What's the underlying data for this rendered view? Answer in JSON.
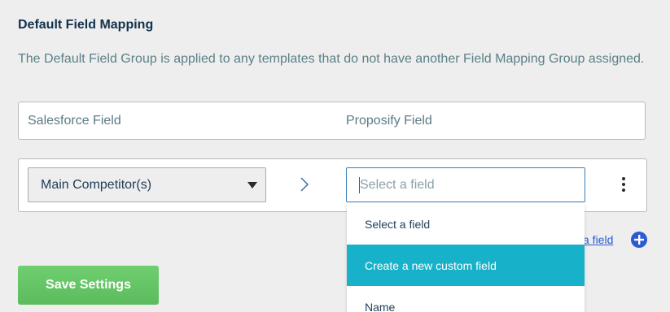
{
  "section": {
    "title": "Default Field Mapping",
    "description": "The Default Field Group is applied to any templates that do not have another Field Mapping Group assigned."
  },
  "table": {
    "headers": {
      "salesforce": "Salesforce Field",
      "proposify": "Proposify Field"
    }
  },
  "mapping_row": {
    "salesforce_selected": "Main Competitor(s)",
    "proposify_placeholder": "Select a field",
    "proposify_value": ""
  },
  "dropdown": {
    "options": [
      "Select a field",
      "Create a new custom field",
      "Name"
    ],
    "highlighted": "Create a new custom field"
  },
  "add_field": {
    "label": "a field"
  },
  "save_button": {
    "label": "Save Settings"
  },
  "colors": {
    "accent": "#17b1c9",
    "save_green": "#5cbc5d",
    "link_blue": "#2a5ad4"
  }
}
